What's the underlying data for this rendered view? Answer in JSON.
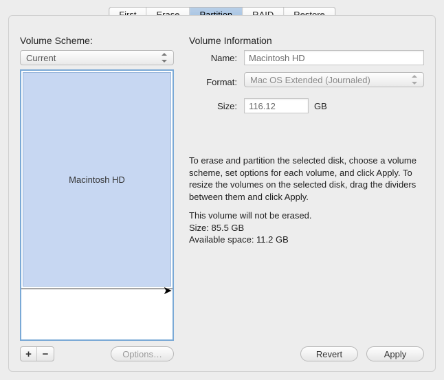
{
  "tabs": {
    "first_aid": "First Aid",
    "erase": "Erase",
    "partition": "Partition",
    "raid": "RAID",
    "restore": "Restore"
  },
  "left": {
    "title": "Volume Scheme:",
    "scheme_dropdown": "Current",
    "volume_name": "Macintosh HD",
    "add": "+",
    "remove": "−",
    "options_btn": "Options…"
  },
  "right": {
    "title": "Volume Information",
    "name_label": "Name:",
    "name_value": "Macintosh HD",
    "format_label": "Format:",
    "format_value": "Mac OS Extended (Journaled)",
    "size_label": "Size:",
    "size_value": "116.12",
    "size_unit": "GB",
    "help_para": "To erase and partition the selected disk, choose a volume scheme, set options for each volume, and click Apply. To resize the volumes on the selected disk, drag the dividers between them and click Apply.",
    "erase_note": "This volume will not be erased.",
    "size_line": "Size: 85.5 GB",
    "avail_line": "Available space: 11.2 GB",
    "revert_btn": "Revert",
    "apply_btn": "Apply"
  }
}
